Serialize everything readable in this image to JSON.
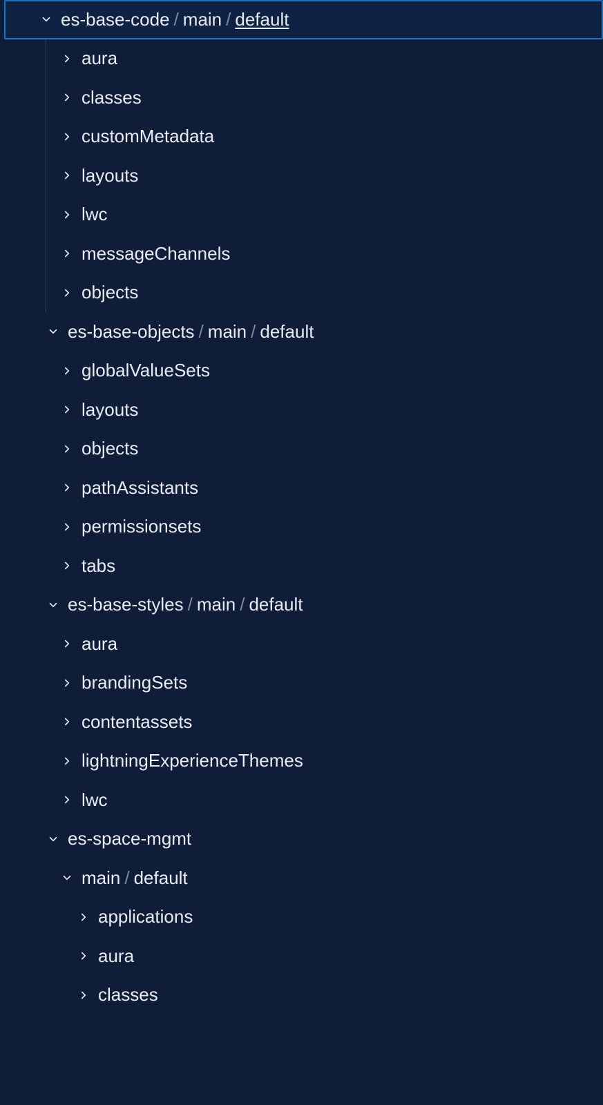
{
  "tree": {
    "nodes": [
      {
        "expanded": true,
        "selected": true,
        "indent": 48,
        "segments": [
          {
            "text": "es-base-code"
          },
          {
            "text": "main"
          },
          {
            "text": "default",
            "underline": true
          }
        ],
        "guide": true,
        "children": [
          {
            "expanded": false,
            "indent": 78,
            "segments": [
              {
                "text": "aura"
              }
            ]
          },
          {
            "expanded": false,
            "indent": 78,
            "segments": [
              {
                "text": "classes"
              }
            ]
          },
          {
            "expanded": false,
            "indent": 78,
            "segments": [
              {
                "text": "customMetadata"
              }
            ]
          },
          {
            "expanded": false,
            "indent": 78,
            "segments": [
              {
                "text": "layouts"
              }
            ]
          },
          {
            "expanded": false,
            "indent": 78,
            "segments": [
              {
                "text": "lwc"
              }
            ]
          },
          {
            "expanded": false,
            "indent": 78,
            "segments": [
              {
                "text": "messageChannels"
              }
            ]
          },
          {
            "expanded": false,
            "indent": 78,
            "segments": [
              {
                "text": "objects"
              }
            ]
          }
        ]
      },
      {
        "expanded": true,
        "indent": 58,
        "segments": [
          {
            "text": "es-base-objects"
          },
          {
            "text": "main"
          },
          {
            "text": "default"
          }
        ],
        "children": [
          {
            "expanded": false,
            "indent": 78,
            "segments": [
              {
                "text": "globalValueSets"
              }
            ]
          },
          {
            "expanded": false,
            "indent": 78,
            "segments": [
              {
                "text": "layouts"
              }
            ]
          },
          {
            "expanded": false,
            "indent": 78,
            "segments": [
              {
                "text": "objects"
              }
            ]
          },
          {
            "expanded": false,
            "indent": 78,
            "segments": [
              {
                "text": "pathAssistants"
              }
            ]
          },
          {
            "expanded": false,
            "indent": 78,
            "segments": [
              {
                "text": "permissionsets"
              }
            ]
          },
          {
            "expanded": false,
            "indent": 78,
            "segments": [
              {
                "text": "tabs"
              }
            ]
          }
        ]
      },
      {
        "expanded": true,
        "indent": 58,
        "segments": [
          {
            "text": "es-base-styles"
          },
          {
            "text": "main"
          },
          {
            "text": "default"
          }
        ],
        "children": [
          {
            "expanded": false,
            "indent": 78,
            "segments": [
              {
                "text": "aura"
              }
            ]
          },
          {
            "expanded": false,
            "indent": 78,
            "segments": [
              {
                "text": "brandingSets"
              }
            ]
          },
          {
            "expanded": false,
            "indent": 78,
            "segments": [
              {
                "text": "contentassets"
              }
            ]
          },
          {
            "expanded": false,
            "indent": 78,
            "segments": [
              {
                "text": "lightningExperienceThemes"
              }
            ]
          },
          {
            "expanded": false,
            "indent": 78,
            "segments": [
              {
                "text": "lwc"
              }
            ]
          }
        ]
      },
      {
        "expanded": true,
        "indent": 58,
        "segments": [
          {
            "text": "es-space-mgmt"
          }
        ],
        "children": [
          {
            "expanded": true,
            "indent": 78,
            "segments": [
              {
                "text": "main"
              },
              {
                "text": "default"
              }
            ],
            "children": [
              {
                "expanded": false,
                "indent": 102,
                "segments": [
                  {
                    "text": "applications"
                  }
                ]
              },
              {
                "expanded": false,
                "indent": 102,
                "segments": [
                  {
                    "text": "aura"
                  }
                ]
              },
              {
                "expanded": false,
                "indent": 102,
                "segments": [
                  {
                    "text": "classes"
                  }
                ]
              }
            ]
          }
        ]
      }
    ]
  }
}
